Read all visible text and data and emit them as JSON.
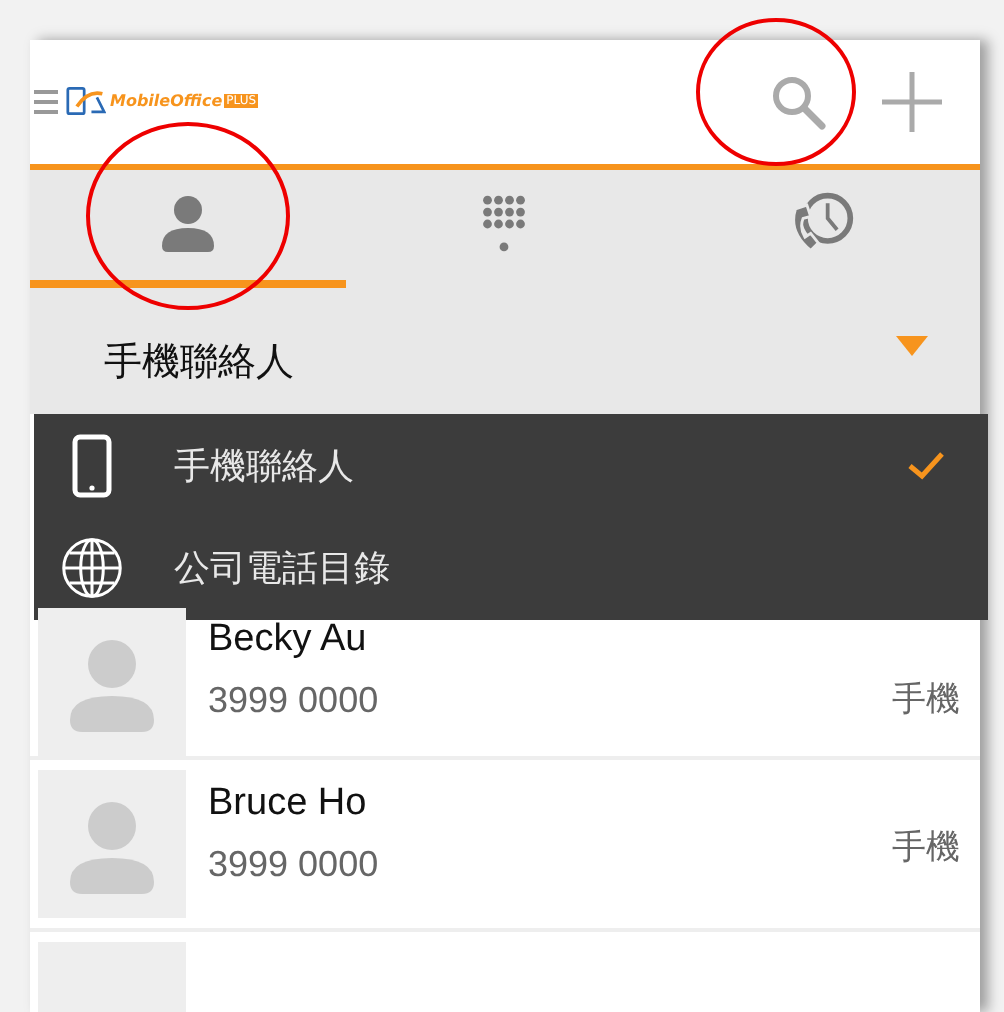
{
  "header": {
    "logo_text": "MobileOffice",
    "logo_badge": "PLUS"
  },
  "tabs": [
    {
      "kind": "contacts",
      "selected": true
    },
    {
      "kind": "dialpad",
      "selected": false
    },
    {
      "kind": "history",
      "selected": false
    }
  ],
  "source_dropdown": {
    "label": "手機聯絡人",
    "expanded": true
  },
  "source_menu": [
    {
      "kind": "phone",
      "label": "手機聯絡人",
      "checked": true
    },
    {
      "kind": "globe",
      "label": "公司電話目錄",
      "checked": false
    }
  ],
  "contacts": [
    {
      "name": "Becky Au",
      "number": "3999 0000",
      "type": "手機"
    },
    {
      "name": "Bruce Ho",
      "number": "3999 0000",
      "type": "手機"
    }
  ]
}
